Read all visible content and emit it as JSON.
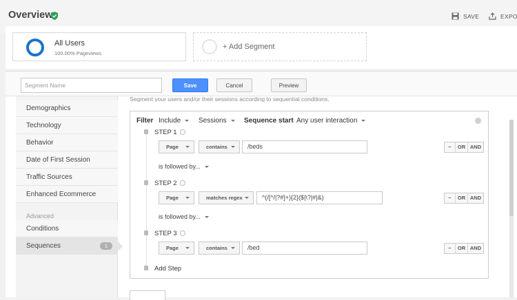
{
  "header": {
    "title": "Overview",
    "save_label": "SAVE",
    "export_label": "EXPO"
  },
  "segments": {
    "active": {
      "name": "All Users",
      "detail": "100.00% Pageviews"
    },
    "add_label": "+ Add Segment"
  },
  "toolbar": {
    "name_placeholder": "Segment Name",
    "save_label": "Save",
    "cancel_label": "Cancel",
    "preview_label": "Preview"
  },
  "nav": {
    "items": [
      "Demographics",
      "Technology",
      "Behavior",
      "Date of First Session",
      "Traffic Sources",
      "Enhanced Ecommerce"
    ],
    "advanced_heading": "Advanced",
    "advanced_items": [
      {
        "label": "Conditions"
      },
      {
        "label": "Sequences",
        "badge": "1"
      }
    ]
  },
  "intro_text": "Segment your users and/or their sessions according to sequential conditions.",
  "filter": {
    "label": "Filter",
    "include": "Include",
    "scope": "Sessions",
    "sequence_start_label": "Sequence start",
    "sequence_start_value": "Any user interaction"
  },
  "steps": [
    {
      "label": "STEP 1",
      "dimension": "Page",
      "operator": "contains",
      "value": "/beds",
      "followed_by": "is followed by..."
    },
    {
      "label": "STEP 2",
      "dimension": "Page",
      "operator": "matches regex",
      "value": "^(/[^/|?#]+){2}($|\\?|#|&)",
      "followed_by": "is followed by..."
    },
    {
      "label": "STEP 3",
      "dimension": "Page",
      "operator": "contains",
      "value": "/bed"
    }
  ],
  "bool_buttons": [
    "−",
    "OR",
    "AND"
  ],
  "add_step_label": "Add Step"
}
